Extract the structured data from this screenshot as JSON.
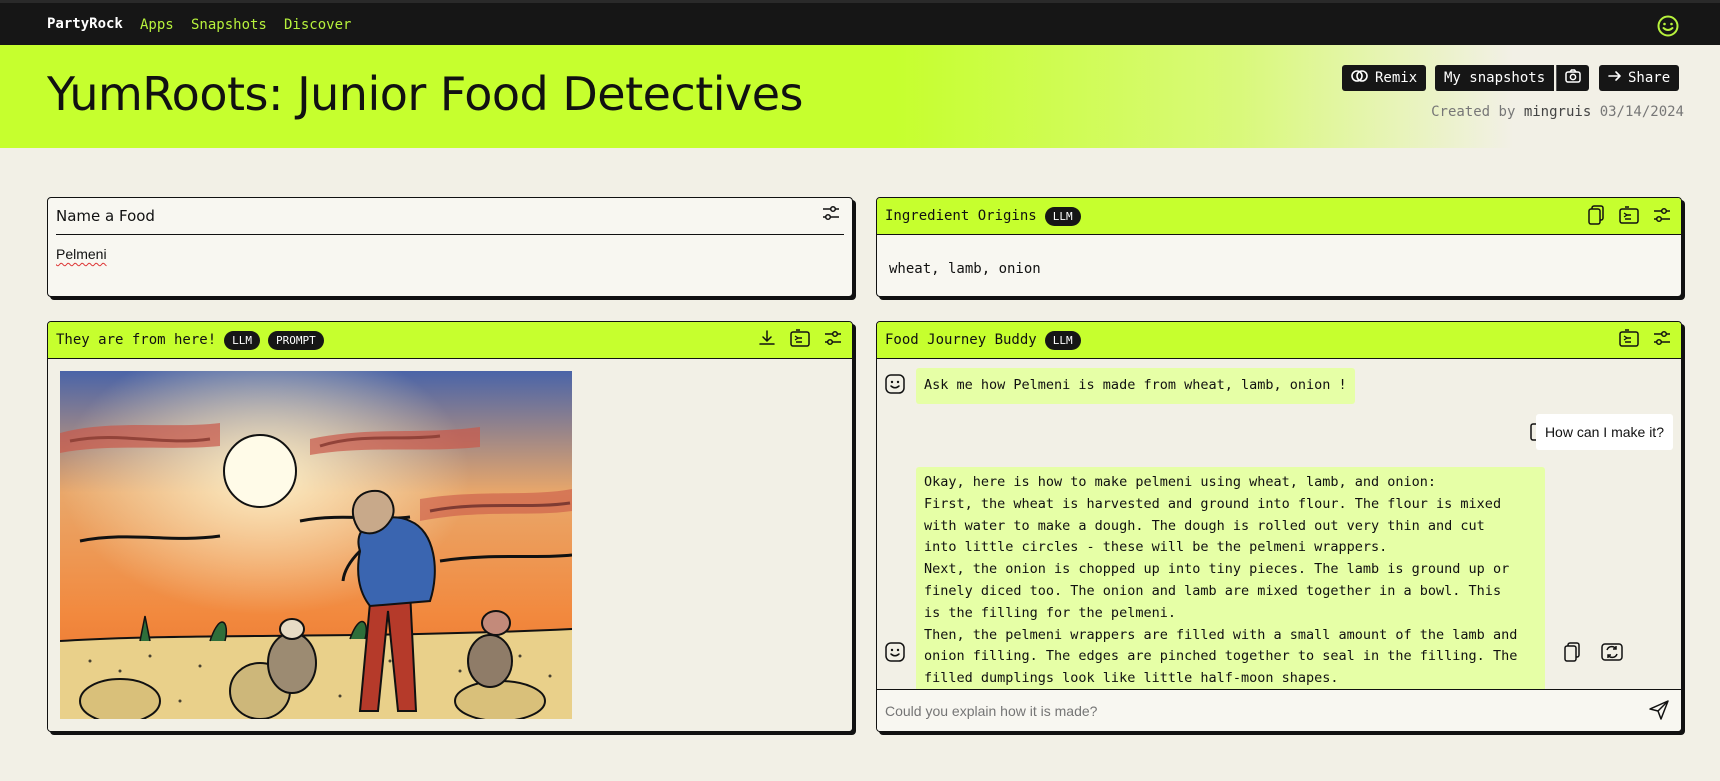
{
  "nav": {
    "brand": "PartyRock",
    "links": [
      "Apps",
      "Snapshots",
      "Discover"
    ],
    "profile_icon": "smiley-icon"
  },
  "hero": {
    "title": "YumRoots: Junior Food Detectives",
    "remix_label": "Remix",
    "snapshots_label": "My snapshots",
    "share_label": "Share",
    "created_prefix": "Created by",
    "author": "mingruis",
    "date": "03/14/2024"
  },
  "widgets": {
    "name_food": {
      "title": "Name a Food",
      "value": "Pelmeni"
    },
    "ingredient_origins": {
      "title": "Ingredient Origins",
      "tag": "LLM",
      "output": "wheat, lamb, onion"
    },
    "image": {
      "title": "They are from here!",
      "tags": [
        "LLM",
        "PROMPT"
      ]
    },
    "chat": {
      "title": "Food Journey Buddy",
      "tag": "LLM",
      "intro_message": "Ask me how Pelmeni is made from wheat, lamb, onion !",
      "user_message": "How can I make it?",
      "response_lines": [
        "Okay, here is how to make pelmeni using wheat, lamb, and onion:",
        "First, the wheat is harvested and ground into flour. The flour is mixed",
        "with water to make a dough. The dough is rolled out very thin and cut",
        "into little circles - these will be the pelmeni wrappers.",
        "Next, the onion is chopped up into tiny pieces. The lamb is ground up or",
        "finely diced too. The onion and lamb are mixed together in a bowl. This",
        "is the filling for the pelmeni.",
        "Then, the pelmeni wrappers are filled with a small amount of the lamb and",
        "onion filling. The edges are pinched together to seal in the filling. The",
        "filled dumplings look like little half-moon shapes."
      ],
      "input_placeholder": "Could you explain how it is made?"
    }
  },
  "colors": {
    "accent": "#c6ff2e",
    "dark": "#161616",
    "bubble": "#e6ffa6",
    "background": "#f2f0e6"
  }
}
